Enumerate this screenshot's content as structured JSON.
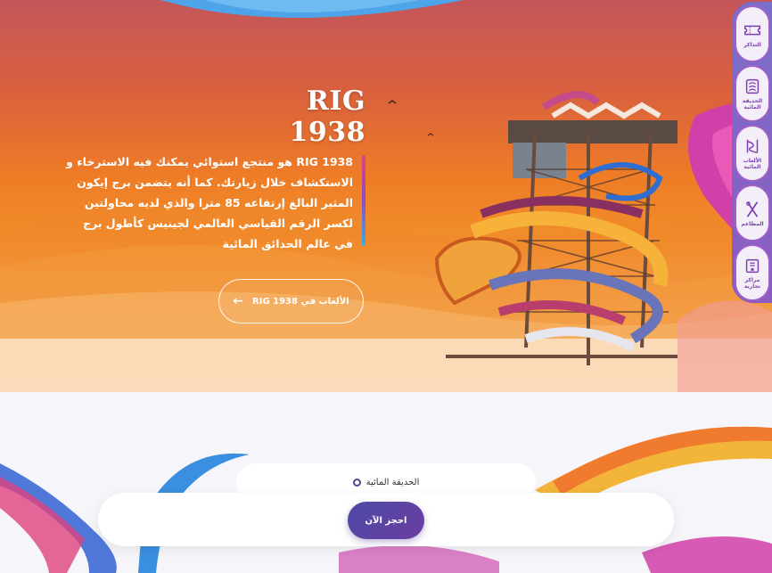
{
  "hero": {
    "title": "RIG 1938",
    "description": "RIG 1938 هو منتجع استوائي يمكنك فيه الاسترخاء و الاستكشاف خلال زيارتك. كما أنه يتضمن برج إيكون المثير البالغ إرتفاعه 85 مترا والذي لديه محاولتين لكسر الرقم القياسي العالمي لجينيس كأطول برج في عالم الحدائق المائية",
    "games_button": "الألعاب في RIG 1938",
    "arrow": "←"
  },
  "side_menu": {
    "items": [
      {
        "label": "التذاكر",
        "icon": "ticket-icon"
      },
      {
        "label": "الحديقة المائية",
        "icon": "waterpark-icon"
      },
      {
        "label": "الألعاب المائية",
        "icon": "slide-icon"
      },
      {
        "label": "المطاعم",
        "icon": "dining-icon"
      },
      {
        "label": "مراكز تجارية",
        "icon": "shop-icon"
      }
    ]
  },
  "booking": {
    "option_label": "الحديقة المائية",
    "book_button": "احجز الآن"
  },
  "colors": {
    "accent": "#5a3f97",
    "menu": "#8b5bc0",
    "hero_top": "#c4565a",
    "hero_mid": "#ee7c26"
  }
}
